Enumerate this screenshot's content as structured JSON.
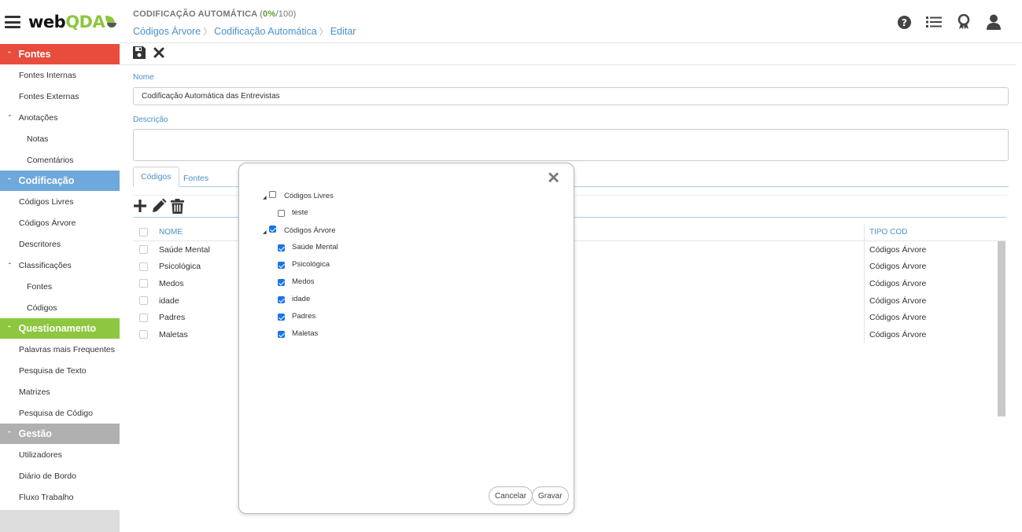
{
  "brand": {
    "name_main": "web",
    "name_accent": "QDA"
  },
  "header": {
    "title": "CODIFICAÇÃO AUTOMÁTICA",
    "progress_open": "(",
    "progress_pct": "0%",
    "progress_total": "/100)",
    "breadcrumb": [
      "Códigos Árvore",
      "Codificação Automática",
      "Editar"
    ],
    "icons": [
      "help-icon",
      "list-icon",
      "award-icon",
      "user-icon"
    ]
  },
  "sidebar": {
    "sections": [
      {
        "title": "Fontes",
        "color": "#e84c3d",
        "items": [
          {
            "label": "Fontes Internas",
            "level": "item"
          },
          {
            "label": "Fontes Externas",
            "level": "item"
          },
          {
            "label": "Anotações",
            "level": "group"
          },
          {
            "label": "Notas",
            "level": "sub"
          },
          {
            "label": "Comentários",
            "level": "sub"
          }
        ]
      },
      {
        "title": "Codificação",
        "color": "#6fa8dc",
        "items": [
          {
            "label": "Códigos Livres",
            "level": "item"
          },
          {
            "label": "Códigos Árvore",
            "level": "item"
          },
          {
            "label": "Descritores",
            "level": "item"
          },
          {
            "label": "Classificações",
            "level": "group"
          },
          {
            "label": "Fontes",
            "level": "sub"
          },
          {
            "label": "Códigos",
            "level": "sub"
          }
        ]
      },
      {
        "title": "Questionamento",
        "color": "#8dc63f",
        "items": [
          {
            "label": "Palavras mais Frequentes",
            "level": "item"
          },
          {
            "label": "Pesquisa de Texto",
            "level": "item"
          },
          {
            "label": "Matrizes",
            "level": "item"
          },
          {
            "label": "Pesquisa de Código",
            "level": "item"
          }
        ]
      },
      {
        "title": "Gestão",
        "color": "#b0b0b0",
        "items": [
          {
            "label": "Utilizadores",
            "level": "item"
          },
          {
            "label": "Diário de Bordo",
            "level": "item"
          },
          {
            "label": "Fluxo Trabalho",
            "level": "item"
          }
        ]
      }
    ]
  },
  "form": {
    "nome_label": "Nome",
    "nome_value": "Codificação Automática das Entrevistas",
    "descricao_label": "Descrição",
    "descricao_value": ""
  },
  "tabs": [
    {
      "label": "Códigos",
      "active": true
    },
    {
      "label": "Fontes",
      "active": false
    }
  ],
  "table": {
    "columns": [
      "NOME",
      "TIPO COD"
    ],
    "rows": [
      {
        "name": "Saúde Mental",
        "tipo": "Códigos Árvore"
      },
      {
        "name": "Psicológica",
        "tipo": "Códigos Árvore"
      },
      {
        "name": "Medos",
        "tipo": "Códigos Árvore"
      },
      {
        "name": "idade",
        "tipo": "Códigos Árvore"
      },
      {
        "name": "Padres",
        "tipo": "Códigos Árvore"
      },
      {
        "name": "Maletas",
        "tipo": "Códigos Árvore"
      }
    ]
  },
  "modal": {
    "close_glyph": "✕",
    "tree": [
      {
        "label": "Códigos Livres",
        "checked": false,
        "children": [
          {
            "label": "teste",
            "checked": false
          }
        ]
      },
      {
        "label": "Códigos Árvore",
        "checked": true,
        "children": [
          {
            "label": "Saúde Mental",
            "checked": true
          },
          {
            "label": "Psicológica",
            "checked": true
          },
          {
            "label": "Medos",
            "checked": true
          },
          {
            "label": "idade",
            "checked": true
          },
          {
            "label": "Padres",
            "checked": true
          },
          {
            "label": "Maletas",
            "checked": true
          }
        ]
      }
    ],
    "cancel_label": "Cancelar",
    "save_label": "Gravar"
  }
}
